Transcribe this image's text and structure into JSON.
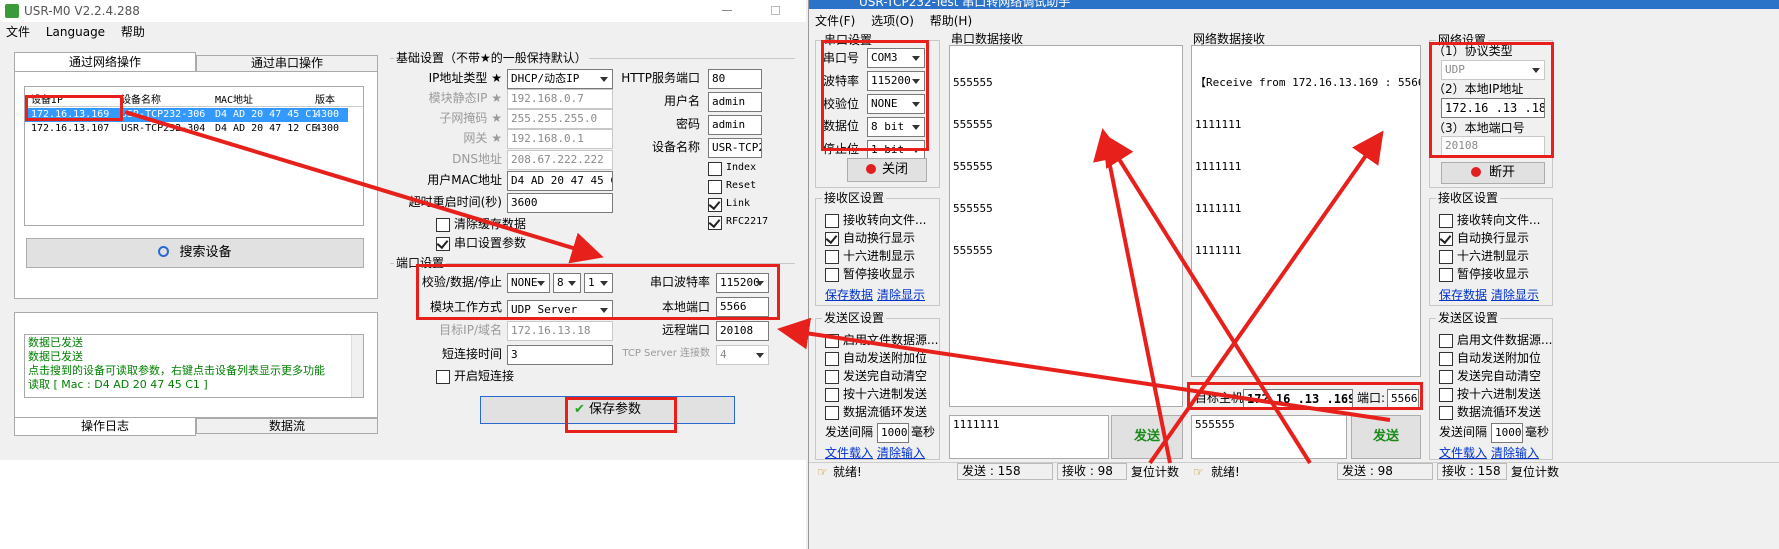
{
  "left_window": {
    "title": "USR-M0 V2.2.4.288",
    "menu": [
      "文件",
      "Language",
      "帮助"
    ],
    "tabs": {
      "network": "通过网络操作",
      "serial": "通过串口操作"
    },
    "device_table": {
      "headers": [
        "设备IP",
        "设备名称",
        "MAC地址",
        "版本"
      ],
      "rows": [
        [
          "172.16.13.169",
          "USR-TCP232-306",
          "D4 AD 20 47 45 C1",
          "4300"
        ],
        [
          "172.16.13.107",
          "USR-TCP232-304",
          "D4 AD 20 47 12 CE",
          "4300"
        ]
      ]
    },
    "search_button": "搜索设备",
    "log_lines": [
      "数据已发送",
      "数据已发送",
      "点击搜到的设备可读取参数，右键点击设备列表显示更多功能",
      "读取 [ Mac : D4 AD 20 47 45 C1 ]"
    ],
    "bottom_tabs": {
      "log": "操作日志",
      "stream": "数据流"
    },
    "basic": {
      "title": "基础设置（不带★的一般保持默认）",
      "ip_type_label": "IP地址类型 ★",
      "ip_type_value": "DHCP/动态IP",
      "static_ip_label": "模块静态IP ★",
      "static_ip_value": "192.168.0.7",
      "mask_label": "子网掩码 ★",
      "mask_value": "255.255.255.0",
      "gateway_label": "网关 ★",
      "gateway_value": "192.168.0.1",
      "dns_label": "DNS地址",
      "dns_value": "208.67.222.222",
      "mac_label": "用户MAC地址",
      "mac_value": "D4 AD 20 47 45 C1",
      "restart_label": "超时重启时间(秒)",
      "restart_value": "3600",
      "clear_cache": "清除缓存数据",
      "serial_params": "串口设置参数",
      "http_port_label": "HTTP服务端口",
      "http_port_value": "80",
      "username_label": "用户名",
      "username_value": "admin",
      "password_label": "密码",
      "password_value": "admin",
      "devname_label": "设备名称",
      "devname_value": "USR-TCP23",
      "index": "Index",
      "reset": "Reset",
      "link": "Link",
      "rfc": "RFC2217"
    },
    "port": {
      "title": "端口设置",
      "check_label": "校验/数据/停止",
      "parity": "NONE",
      "databits": "8",
      "stopbits": "1",
      "baud_label": "串口波特率",
      "baud_value": "115200",
      "mode_label": "模块工作方式",
      "mode_value": "UDP Server",
      "local_port_label": "本地端口",
      "local_port_value": "5566",
      "target_label": "目标IP/域名",
      "target_value": "172.16.13.18",
      "remote_port_label": "远程端口",
      "remote_port_value": "20108",
      "short_label": "短连接时间",
      "short_value": "3",
      "tcp_label": "TCP Server 连接数",
      "tcp_value": "4",
      "enable_short": "开启短连接"
    },
    "save_button": "保存参数"
  },
  "right_window": {
    "title": "USR-TCP232-Test 串口转网络调试助手",
    "menu": [
      "文件(F)",
      "选项(O)",
      "帮助(H)"
    ],
    "serial_settings": {
      "title": "串口设置",
      "port_label": "串口号",
      "port_value": "COM3",
      "baud_label": "波特率",
      "baud_value": "115200",
      "parity_label": "校验位",
      "parity_value": "NONE",
      "data_label": "数据位",
      "data_value": "8 bit",
      "stop_label": "停止位",
      "stop_value": "1 bit",
      "close_button": "关闭"
    },
    "recv_settings_left": {
      "title": "接收区设置",
      "options": [
        "接收转向文件...",
        "自动换行显示",
        "十六进制显示",
        "暂停接收显示"
      ],
      "save_link": "保存数据",
      "clear_link": "清除显示"
    },
    "send_settings_left": {
      "title": "发送区设置",
      "options": [
        "启用文件数据源...",
        "自动发送附加位",
        "发送完自动清空",
        "按十六进制发送",
        "数据流循环发送"
      ],
      "interval_label": "发送间隔",
      "interval_value": "1000",
      "interval_unit": "毫秒",
      "load_link": "文件载入",
      "clear_input_link": "清除输入"
    },
    "serial_recv": {
      "title": "串口数据接收",
      "lines": [
        "555555",
        "555555",
        "555555",
        "555555",
        "555555"
      ]
    },
    "serial_send_text": "1111111",
    "send_button": "发送",
    "net_recv": {
      "title": "网络数据接收",
      "lines": [
        "【Receive from 172.16.13.169 : 5566】:",
        "1111111",
        "1111111",
        "1111111",
        "1111111"
      ]
    },
    "target_host_label": "目标主机:",
    "target_host_value": "172.16 .13 .169",
    "target_port_label": "端口:",
    "target_port_value": "5566",
    "net_send_text": "555555",
    "net_settings": {
      "title": "网络设置",
      "protocol_label": "（1）协议类型",
      "protocol_value": "UDP",
      "local_ip_label": "（2）本地IP地址",
      "local_ip_value": "172.16 .13 .18",
      "local_port_label": "（3）本地端口号",
      "local_port_value": "20108",
      "open_button": "断开"
    },
    "recv_settings_right": {
      "title": "接收区设置",
      "options": [
        "接收转向文件...",
        "自动换行显示",
        "十六进制显示",
        "暂停接收显示"
      ],
      "save_link": "保存数据",
      "clear_link": "清除显示"
    },
    "send_settings_right": {
      "title": "发送区设置",
      "options": [
        "启用文件数据源...",
        "自动发送附加位",
        "发送完自动清空",
        "按十六进制发送",
        "数据流循环发送"
      ],
      "interval_label": "发送间隔",
      "interval_value": "1000",
      "interval_unit": "毫秒",
      "load_link": "文件载入",
      "clear_input_link": "清除输入"
    },
    "status": {
      "ready_left": "就绪!",
      "sent_left": "发送 : 158",
      "recv_left": "接收 : 98",
      "reset_left": "复位计数",
      "ready_right": "就绪!",
      "sent_right": "发送 : 98",
      "recv_right": "接收 : 158",
      "reset_right": "复位计数"
    }
  },
  "colors": {
    "annotation_red": "#e8201c",
    "selection_blue": "#3399ff",
    "log_green": "#008000",
    "link_blue": "#0033cc"
  }
}
